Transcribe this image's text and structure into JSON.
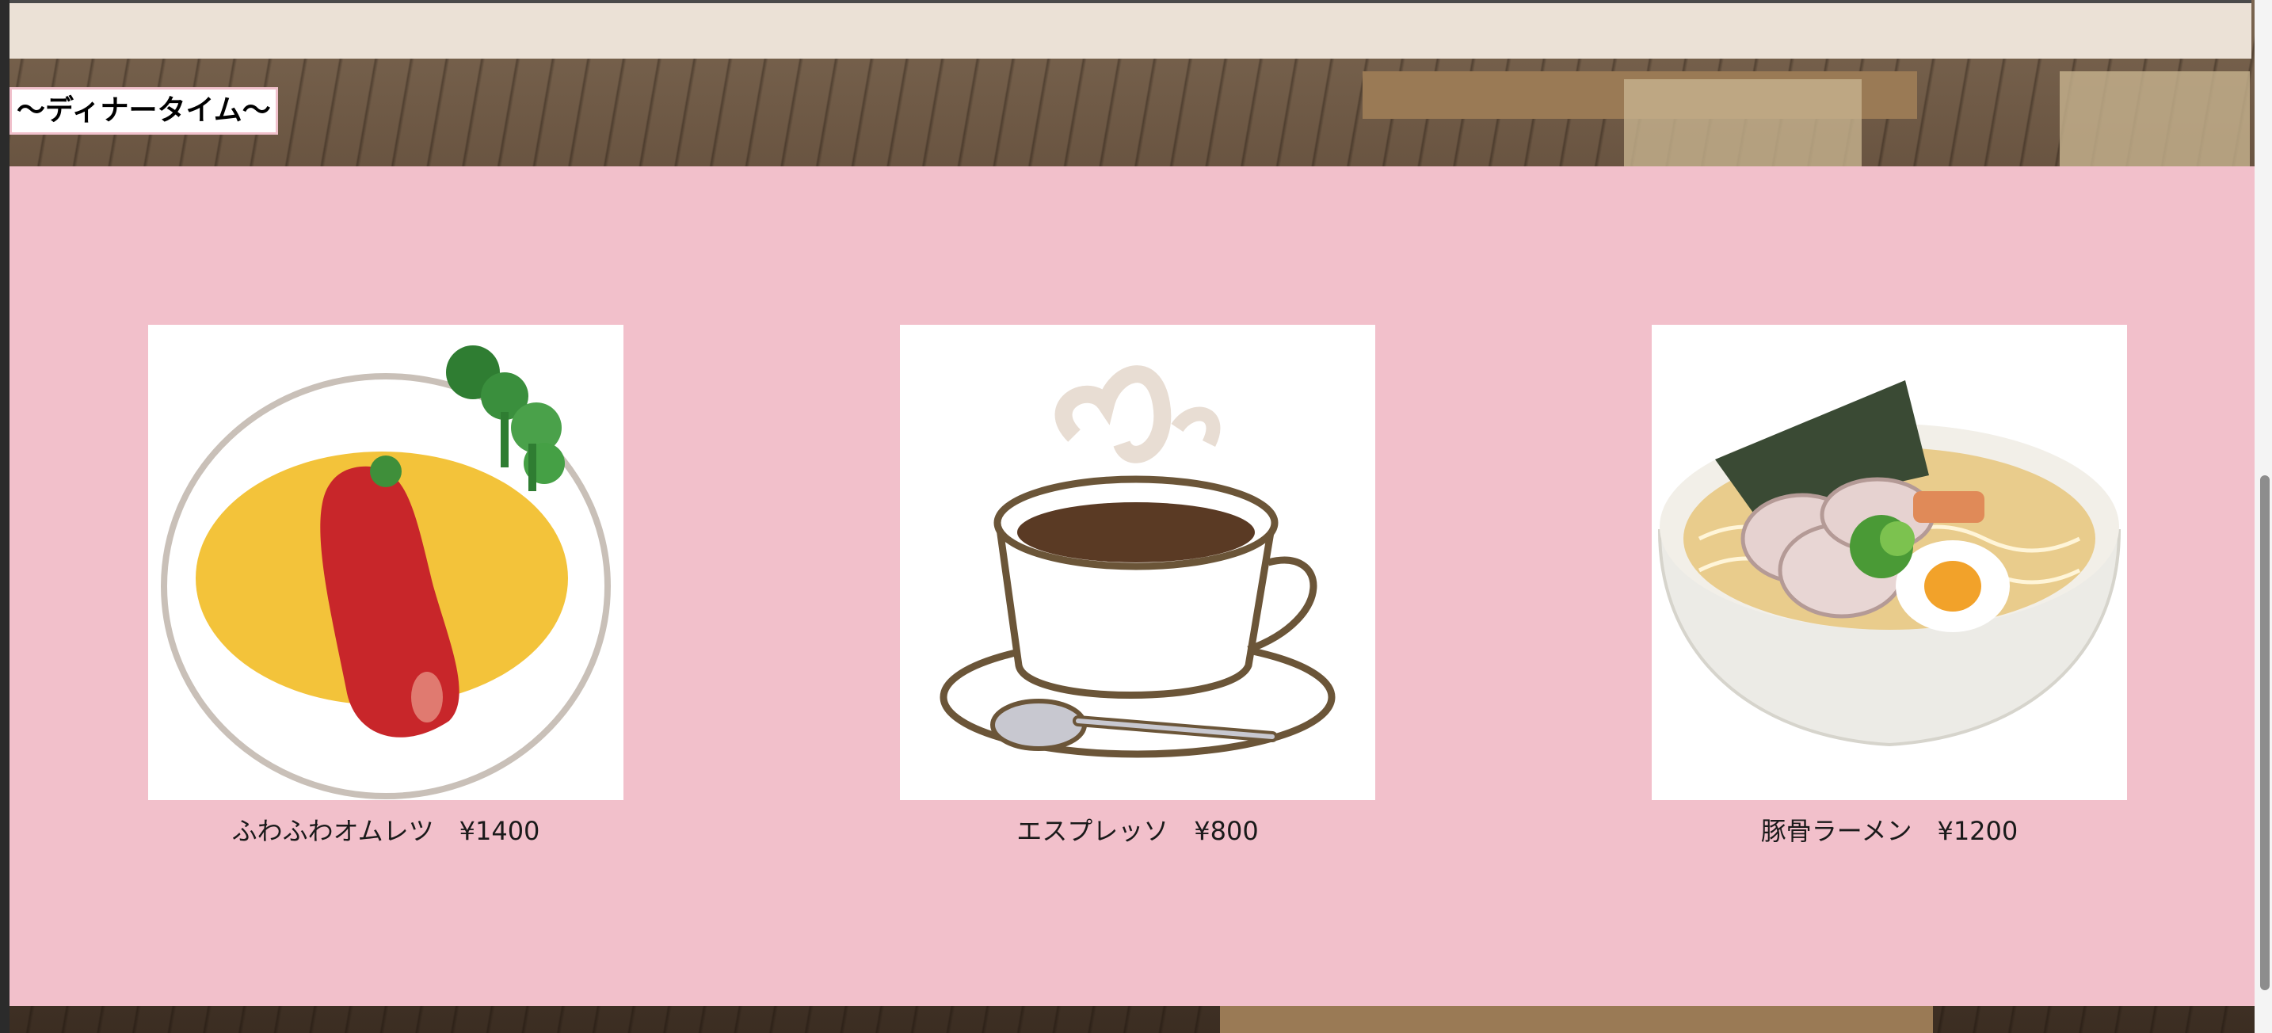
{
  "section": {
    "title": "〜ディナータイム〜"
  },
  "menu": {
    "items": [
      {
        "name": "ふわふわオムレツ",
        "price": "¥1400",
        "caption": "ふわふわオムレツ　¥1400",
        "icon": "omelette-icon"
      },
      {
        "name": "エスプレッソ",
        "price": "¥800",
        "caption": "エスプレッソ　¥800",
        "icon": "espresso-cup-icon"
      },
      {
        "name": "豚骨ラーメン",
        "price": "¥1200",
        "caption": "豚骨ラーメン　¥1200",
        "icon": "ramen-bowl-icon"
      }
    ]
  },
  "colors": {
    "panel": "#f2c0cb",
    "title_border": "#f0c0cb",
    "topbar": "#ebe1d6"
  }
}
